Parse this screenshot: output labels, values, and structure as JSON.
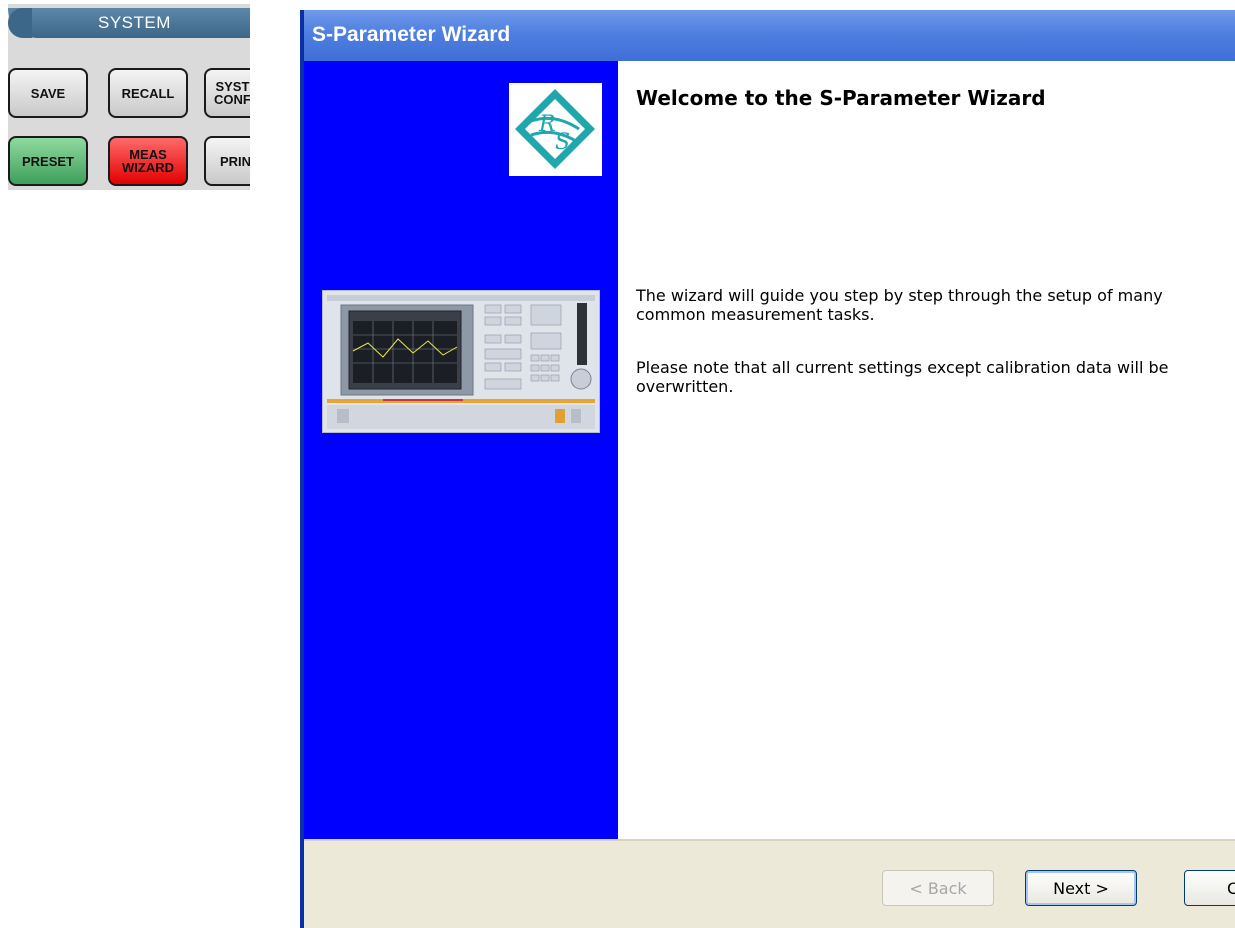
{
  "system_panel": {
    "title": "SYSTEM",
    "buttons": {
      "save": "SAVE",
      "recall": "RECALL",
      "system_config": "SYST\nCONF",
      "preset": "PRESET",
      "meas_wizard": "MEAS\nWIZARD",
      "print": "PRIN"
    },
    "colors": {
      "preset": "#4fae6a",
      "meas_wizard": "#ee1111",
      "header": "#4b7595"
    }
  },
  "wizard": {
    "title": "S-Parameter Wizard",
    "heading": "Welcome to the S-Parameter Wizard",
    "intro": "The wizard will guide you step by step through the setup of many common measurement tasks.",
    "note": "Please note that all current settings except calibration data will be overwritten.",
    "logo_text": "RS",
    "buttons": {
      "back": "< Back",
      "next": "Next >",
      "cancel": "C"
    },
    "colors": {
      "side_panel": "#0000ff",
      "title_bar": "#4f7fe0",
      "logo": "#1aa0a8"
    }
  }
}
